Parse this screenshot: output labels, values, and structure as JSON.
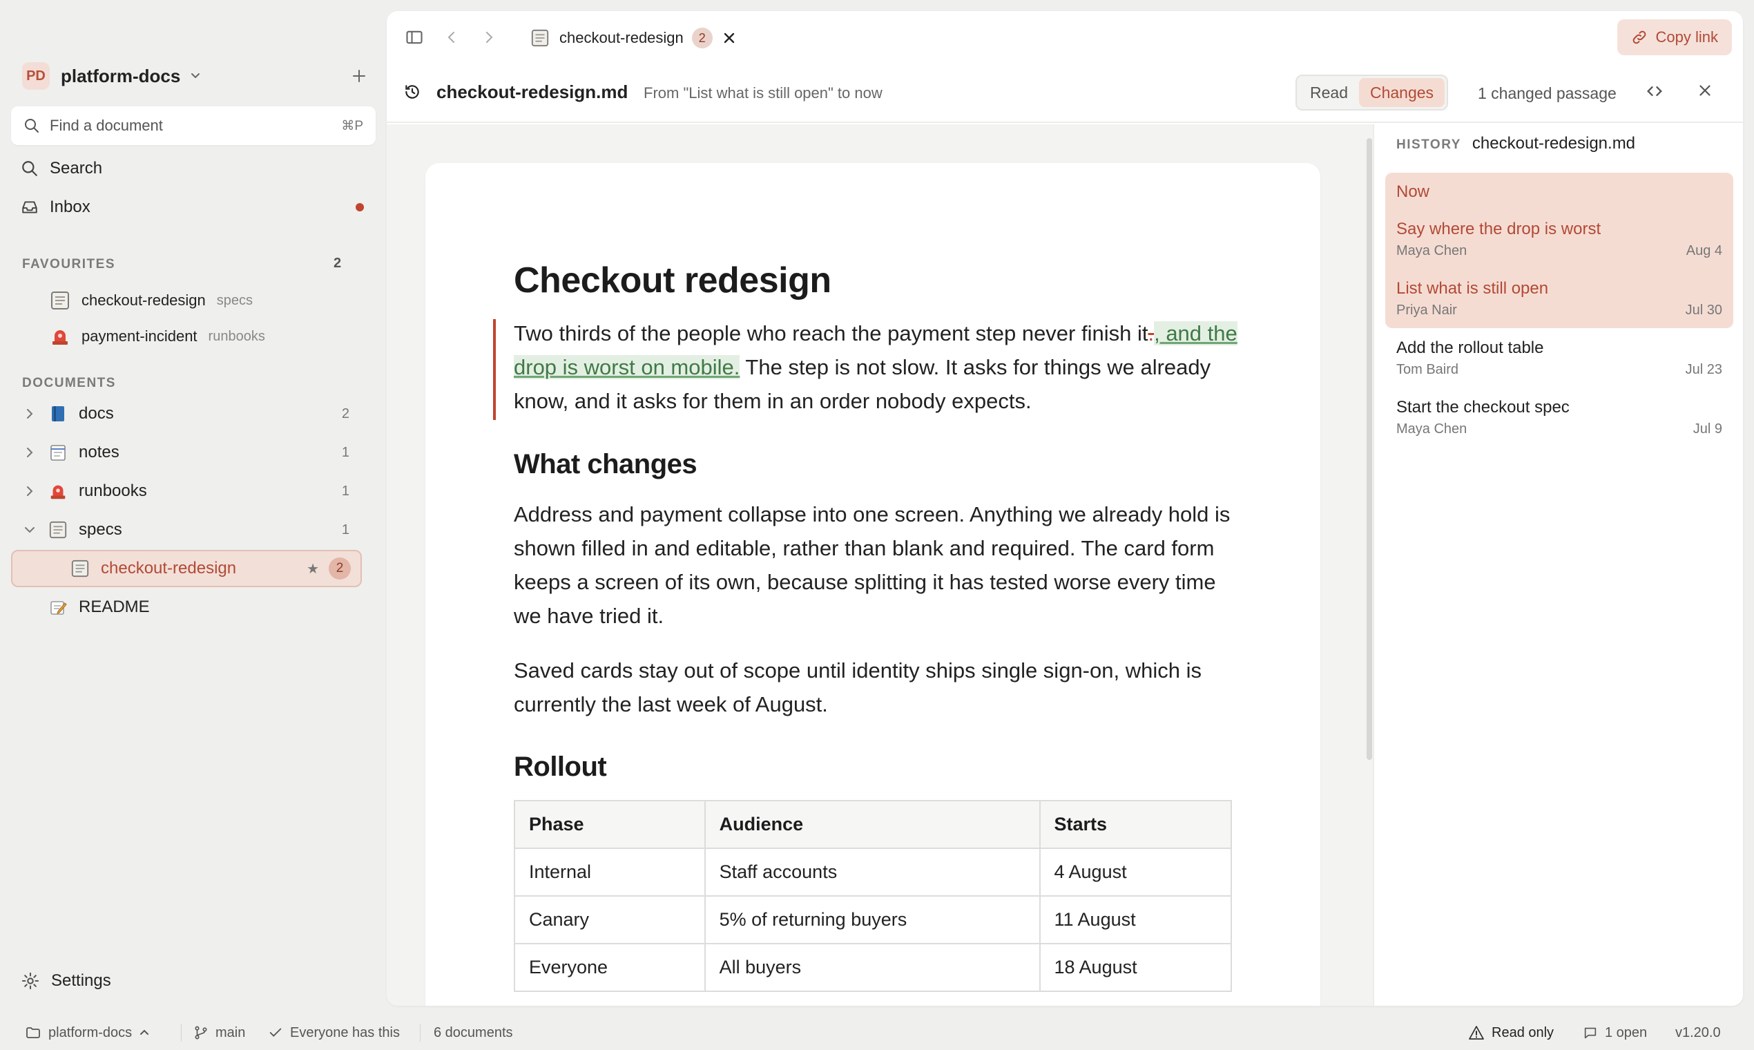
{
  "workspace": {
    "initials": "PD",
    "name": "platform-docs"
  },
  "finder": {
    "placeholder": "Find a document",
    "shortcut": "⌘P"
  },
  "nav": {
    "search": "Search",
    "inbox": "Inbox"
  },
  "favourites": {
    "heading": "FAVOURITES",
    "count": "2",
    "items": [
      {
        "label": "checkout-redesign",
        "folder": "specs",
        "icon": "spec-doc-icon"
      },
      {
        "label": "payment-incident",
        "folder": "runbooks",
        "icon": "siren-icon"
      }
    ]
  },
  "documents": {
    "heading": "DOCUMENTS",
    "folders": [
      {
        "label": "docs",
        "count": "2",
        "icon": "book-icon",
        "expanded": false
      },
      {
        "label": "notes",
        "count": "1",
        "icon": "notepad-icon",
        "expanded": false
      },
      {
        "label": "runbooks",
        "count": "1",
        "icon": "siren-icon",
        "expanded": false
      },
      {
        "label": "specs",
        "count": "1",
        "icon": "spec-doc-icon",
        "expanded": true
      }
    ],
    "active": {
      "label": "checkout-redesign",
      "star": "★",
      "badge": "2"
    },
    "readme": {
      "label": "README",
      "icon": "memo-icon"
    }
  },
  "settings": {
    "label": "Settings"
  },
  "statusbar": {
    "workspace": "platform-docs",
    "branch": "main",
    "sync": "Everyone has this",
    "doc_count": "6 documents",
    "mode": "Read only",
    "comments": "1 open",
    "version": "v1.20.0"
  },
  "tabbar": {
    "tab": {
      "label": "checkout-redesign",
      "badge": "2"
    },
    "copy_link": "Copy link"
  },
  "docbar": {
    "filename": "checkout-redesign.md",
    "range": "From \"List what is still open\" to now",
    "modes": [
      "Read",
      "Changes"
    ],
    "active_mode": "Changes",
    "changed": "1 changed passage"
  },
  "document": {
    "title": "Checkout redesign",
    "intro": {
      "before": "Two thirds of the people who reach the payment step never finish it",
      "deleted": ".",
      "inserted": ", and the drop is worst on mobile.",
      "after": " The step is not slow. It asks for things we already know, and it asks for them in an order nobody expects."
    },
    "h_changes": "What changes",
    "p_changes": "Address and payment collapse into one screen. Anything we already hold is shown filled in and editable, rather than blank and required. The card form keeps a screen of its own, because splitting it has tested worse every time we have tried it.",
    "p_scope": "Saved cards stay out of scope until identity ships single sign-on, which is currently the last week of August.",
    "h_rollout": "Rollout",
    "table": {
      "headers": [
        "Phase",
        "Audience",
        "Starts"
      ],
      "rows": [
        [
          "Internal",
          "Staff accounts",
          "4 August"
        ],
        [
          "Canary",
          "5% of returning buyers",
          "11 August"
        ],
        [
          "Everyone",
          "All buyers",
          "18 August"
        ]
      ]
    }
  },
  "history": {
    "heading": "HISTORY",
    "file": "checkout-redesign.md",
    "now": "Now",
    "entries": [
      {
        "title": "Say where the drop is worst",
        "author": "Maya Chen",
        "date": "Aug 4"
      },
      {
        "title": "List what is still open",
        "author": "Priya Nair",
        "date": "Jul 30"
      },
      {
        "title": "Add the rollout table",
        "author": "Tom Baird",
        "date": "Jul 23"
      },
      {
        "title": "Start the checkout spec",
        "author": "Maya Chen",
        "date": "Jul 9"
      }
    ]
  },
  "colors": {
    "accent": "#b14a35",
    "accent_bg": "#f5dcd3",
    "deleted": "#c0442e",
    "inserted": "#3f7a46",
    "inserted_bg": "#e4efe3"
  }
}
